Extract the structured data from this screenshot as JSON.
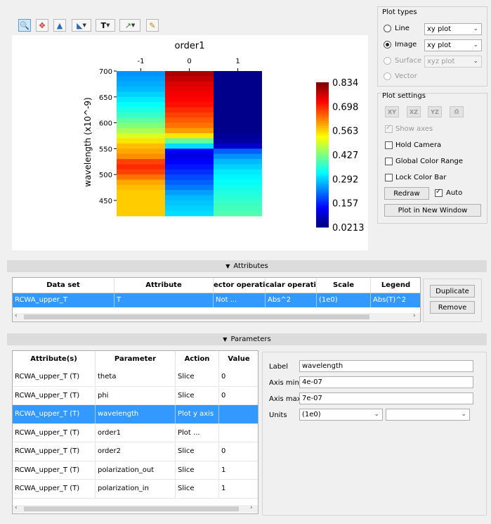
{
  "toolbar": {
    "icons": [
      "zoom-icon",
      "pan-icon",
      "mountain-icon",
      "plot-dropdown-icon",
      "text-dropdown-icon",
      "marker-dropdown-icon",
      "pencil-icon"
    ],
    "glyphs": [
      "🔍",
      "✥",
      "▲",
      "◣",
      "T",
      "↗",
      "✎"
    ]
  },
  "plot": {
    "title": "order1",
    "ylabel": "wavelength (x10^-9)",
    "x_ticks": [
      "-1",
      "0",
      "1"
    ],
    "y_ticks": [
      "700",
      "650",
      "600",
      "550",
      "500",
      "450"
    ],
    "colorbar_ticks": [
      "0.834",
      "0.698",
      "0.563",
      "0.427",
      "0.292",
      "0.157",
      "0.0213"
    ]
  },
  "chart_data": {
    "type": "heatmap",
    "title": "order1",
    "xlabel": "",
    "ylabel": "wavelength (x10^-9)",
    "x_categories": [
      "-1",
      "0",
      "1"
    ],
    "ylim": [
      420,
      700
    ],
    "clim": [
      0.0213,
      0.834
    ],
    "columns": [
      {
        "x": "-1",
        "y": [
          700,
          690,
          680,
          670,
          660,
          650,
          640,
          630,
          620,
          610,
          600,
          590,
          580,
          570,
          560,
          550,
          540,
          530,
          520,
          510,
          500,
          490,
          480,
          470,
          460,
          450,
          440,
          430
        ],
        "values": [
          0.24,
          0.25,
          0.26,
          0.27,
          0.29,
          0.31,
          0.33,
          0.35,
          0.37,
          0.4,
          0.43,
          0.46,
          0.5,
          0.55,
          0.58,
          0.6,
          0.62,
          0.68,
          0.7,
          0.68,
          0.64,
          0.6,
          0.58,
          0.57,
          0.57,
          0.57,
          0.57,
          0.57
        ]
      },
      {
        "x": "0",
        "y": [
          700,
          690,
          680,
          670,
          660,
          650,
          640,
          630,
          620,
          610,
          600,
          590,
          580,
          570,
          560,
          550,
          540,
          530,
          520,
          510,
          500,
          490,
          480,
          470,
          460,
          450,
          440,
          430
        ],
        "values": [
          0.8,
          0.78,
          0.76,
          0.75,
          0.74,
          0.73,
          0.72,
          0.7,
          0.68,
          0.66,
          0.64,
          0.61,
          0.55,
          0.4,
          0.3,
          0.12,
          0.1,
          0.12,
          0.14,
          0.16,
          0.18,
          0.2,
          0.22,
          0.25,
          0.27,
          0.28,
          0.29,
          0.3
        ]
      },
      {
        "x": "1",
        "y": [
          700,
          690,
          680,
          670,
          660,
          650,
          640,
          630,
          620,
          610,
          600,
          590,
          580,
          570,
          560,
          550,
          540,
          530,
          520,
          510,
          500,
          490,
          480,
          470,
          460,
          450,
          440,
          430
        ],
        "values": [
          0.03,
          0.03,
          0.03,
          0.03,
          0.03,
          0.03,
          0.03,
          0.03,
          0.03,
          0.03,
          0.03,
          0.03,
          0.04,
          0.05,
          0.08,
          0.2,
          0.24,
          0.27,
          0.29,
          0.31,
          0.32,
          0.33,
          0.34,
          0.35,
          0.36,
          0.37,
          0.38,
          0.39
        ]
      }
    ],
    "colormap": "jet",
    "colorbar_ticks": [
      0.834,
      0.698,
      0.563,
      0.427,
      0.292,
      0.157,
      0.0213
    ]
  },
  "plot_types": {
    "title": "Plot types",
    "line_label": "Line",
    "line_combo": "xy plot",
    "image_label": "Image",
    "image_combo": "xy plot",
    "surface_label": "Surface",
    "surface_combo": "xyz plot",
    "vector_label": "Vector"
  },
  "plot_settings": {
    "title": "Plot settings",
    "view_buttons": [
      "XY",
      "XZ",
      "YZ",
      "⎙"
    ],
    "show_axes": "Show axes",
    "hold_camera": "Hold Camera",
    "global_color_range": "Global Color Range",
    "lock_color_bar": "Lock Color Bar",
    "redraw": "Redraw",
    "auto": "Auto",
    "plot_new_window": "Plot in New Window"
  },
  "attributes": {
    "section_label": "Attributes",
    "columns": [
      "Data set",
      "Attribute",
      "ector operatio",
      "calar operatio",
      "Scale",
      "Legend"
    ],
    "rows": [
      [
        "RCWA_upper_T",
        "T",
        "Not ...",
        "Abs^2",
        "(1e0)",
        "Abs(T)^2"
      ]
    ],
    "duplicate": "Duplicate",
    "remove": "Remove"
  },
  "parameters": {
    "section_label": "Parameters",
    "columns": [
      "Attribute(s)",
      "Parameter",
      "Action",
      "Value"
    ],
    "rows": [
      [
        "RCWA_upper_T (T)",
        "theta",
        "Slice",
        "0"
      ],
      [
        "RCWA_upper_T (T)",
        "phi",
        "Slice",
        "0"
      ],
      [
        "RCWA_upper_T (T)",
        "wavelength",
        "Plot y axis",
        ""
      ],
      [
        "RCWA_upper_T (T)",
        "order1",
        "Plot ...",
        ""
      ],
      [
        "RCWA_upper_T (T)",
        "order2",
        "Slice",
        "0"
      ],
      [
        "RCWA_upper_T (T)",
        "polarization_out",
        "Slice",
        "1"
      ],
      [
        "RCWA_upper_T (T)",
        "polarization_in",
        "Slice",
        "1"
      ]
    ],
    "label_label": "Label",
    "label_value": "wavelength",
    "axis_min_label": "Axis min",
    "axis_min_value": "4e-07",
    "axis_max_label": "Axis max",
    "axis_max_value": "7e-07",
    "units_label": "Units",
    "units_value": "(1e0)",
    "units_value2": ""
  },
  "colors": {
    "selection": "#3399ff",
    "selection_text": "#ffffff"
  }
}
